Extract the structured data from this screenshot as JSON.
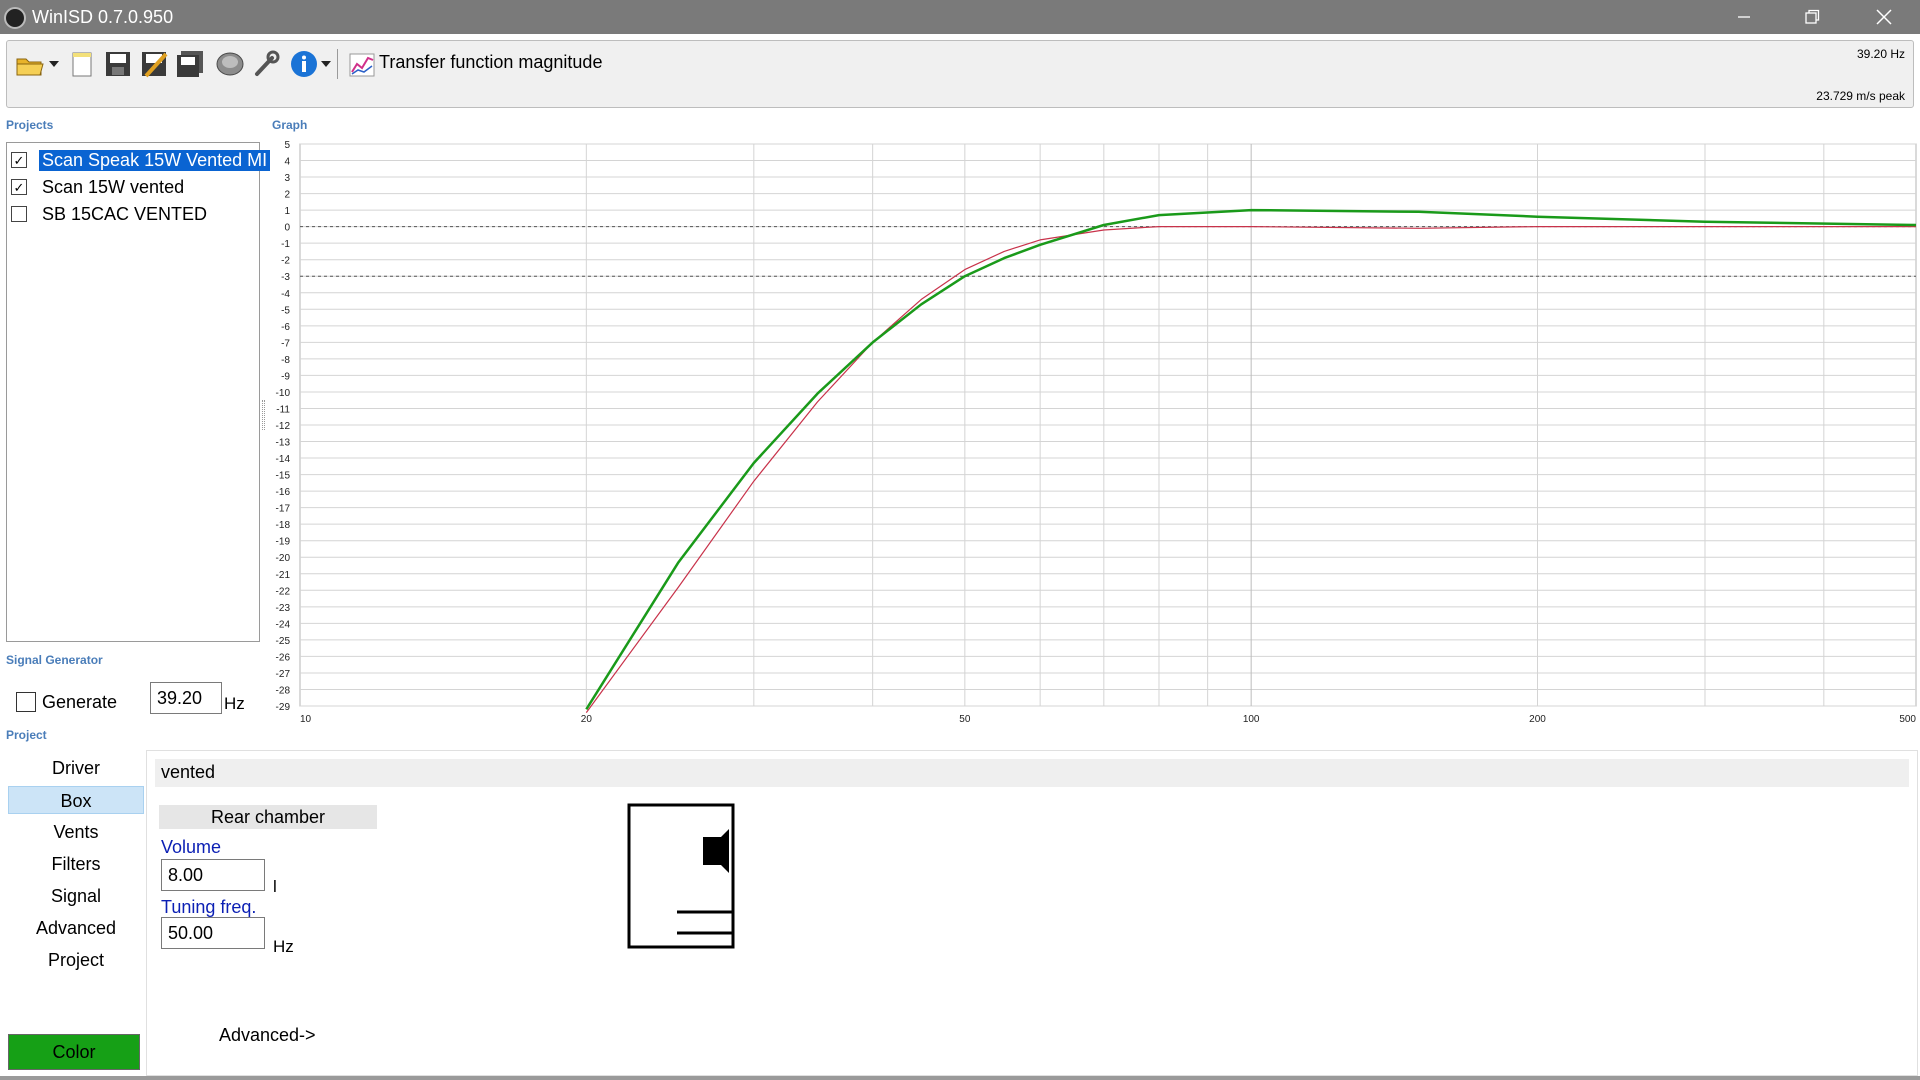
{
  "window": {
    "title": "WinISD 0.7.0.950"
  },
  "toolbar": {
    "graph_type_label": "Transfer function magnitude",
    "freq_readout": "39.20 Hz",
    "peak_readout": "23.729 m/s peak"
  },
  "sections": {
    "projects": "Projects",
    "graph": "Graph",
    "signal_generator": "Signal Generator",
    "project": "Project"
  },
  "projects": [
    {
      "name": "Scan Speak 15W Vented MI",
      "checked": true,
      "selected": true
    },
    {
      "name": "Scan 15W vented",
      "checked": true,
      "selected": false
    },
    {
      "name": "SB 15CAC VENTED",
      "checked": false,
      "selected": false
    }
  ],
  "signal_generator": {
    "generate_label": "Generate",
    "frequency": "39.20",
    "unit": "Hz"
  },
  "nav": [
    "Driver",
    "Box",
    "Vents",
    "Filters",
    "Signal",
    "Advanced",
    "Project"
  ],
  "nav_active": "Box",
  "color_button": {
    "label": "Color",
    "color": "#16a016"
  },
  "box_panel": {
    "type": "vented",
    "chamber": "Rear chamber",
    "volume": {
      "label": "Volume",
      "value": "8.00",
      "unit": "l"
    },
    "tuning": {
      "label": "Tuning freq.",
      "value": "50.00",
      "unit": "Hz"
    },
    "advanced_link": "Advanced->"
  },
  "chart_data": {
    "type": "line",
    "x_scale": "log",
    "xlim": [
      10,
      500
    ],
    "ylim": [
      -29,
      5
    ],
    "x_ticks": [
      10,
      20,
      50,
      100,
      200,
      500
    ],
    "y_ticks": [
      5,
      4,
      3,
      2,
      1,
      0,
      -1,
      -2,
      -3,
      -4,
      -5,
      -6,
      -7,
      -8,
      -9,
      -10,
      -11,
      -12,
      -13,
      -14,
      -15,
      -16,
      -17,
      -18,
      -19,
      -20,
      -21,
      -22,
      -23,
      -24,
      -25,
      -26,
      -27,
      -28,
      -29
    ],
    "reference_lines": [
      0,
      -3
    ],
    "grid": true,
    "series": [
      {
        "color": "#1a9a1a",
        "x": [
          20,
          25,
          30,
          35,
          40,
          45,
          50,
          55,
          60,
          70,
          80,
          100,
          150,
          200,
          300,
          500
        ],
        "y": [
          -29.2,
          -20.3,
          -14.3,
          -10.1,
          -7.0,
          -4.7,
          -3.0,
          -1.9,
          -1.1,
          0.1,
          0.7,
          1.0,
          0.9,
          0.6,
          0.3,
          0.1
        ]
      },
      {
        "color": "#c8324a",
        "x": [
          20,
          25,
          30,
          35,
          40,
          45,
          50,
          55,
          60,
          70,
          80,
          100,
          150,
          200,
          300,
          500
        ],
        "y": [
          -29.4,
          -21.8,
          -15.4,
          -10.6,
          -7.0,
          -4.4,
          -2.6,
          -1.5,
          -0.8,
          -0.2,
          0.0,
          0.0,
          -0.1,
          0.0,
          0.0,
          0.0
        ]
      }
    ]
  }
}
